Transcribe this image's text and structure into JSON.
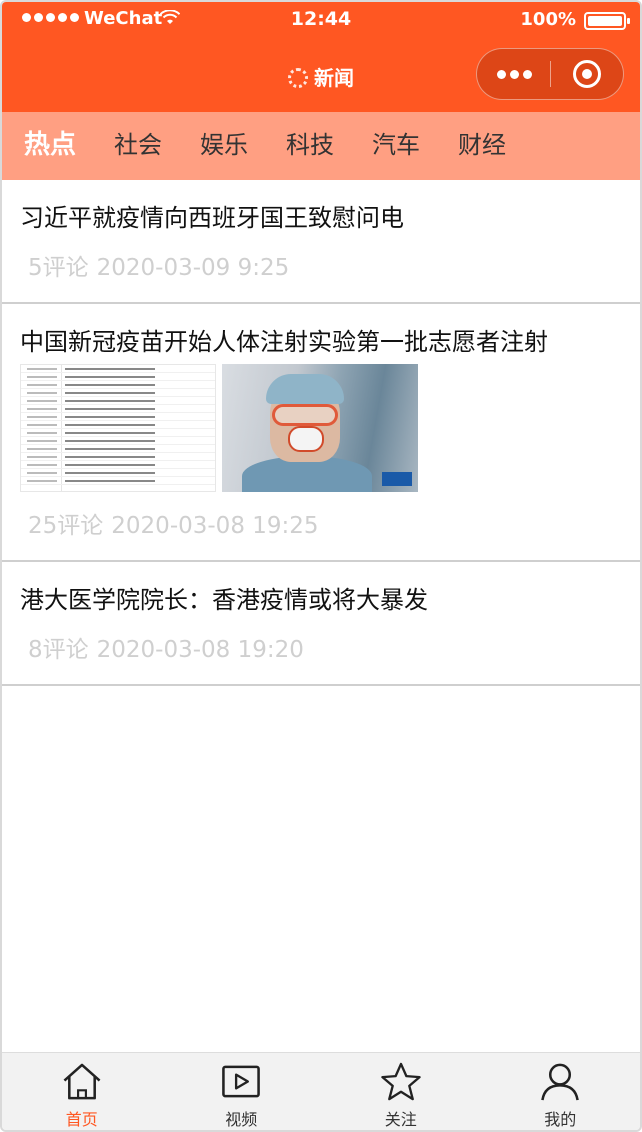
{
  "status_bar": {
    "carrier": "WeChat",
    "time": "12:44",
    "battery": "100%"
  },
  "nav": {
    "title": "新闻"
  },
  "tabs": [
    {
      "label": "热点",
      "active": true
    },
    {
      "label": "社会",
      "active": false
    },
    {
      "label": "娱乐",
      "active": false
    },
    {
      "label": "科技",
      "active": false
    },
    {
      "label": "汽车",
      "active": false
    },
    {
      "label": "财经",
      "active": false
    }
  ],
  "news": [
    {
      "title": "习近平就疫情向西班牙国王致慰问电",
      "comments": "5评论",
      "time": "2020-03-09 9:25"
    },
    {
      "title": "中国新冠疫苗开始人体注射实验第一批志愿者注射",
      "comments": "25评论",
      "time": "2020-03-08 19:25"
    },
    {
      "title": "港大医学院院长：香港疫情或将大暴发",
      "comments": "8评论",
      "time": "2020-03-08 19:20"
    }
  ],
  "tabbar": [
    {
      "label": "首页",
      "icon": "home-icon",
      "active": true
    },
    {
      "label": "视频",
      "icon": "video-icon",
      "active": false
    },
    {
      "label": "关注",
      "icon": "star-icon",
      "active": false
    },
    {
      "label": "我的",
      "icon": "user-icon",
      "active": false
    }
  ],
  "colors": {
    "brand": "#ff5722",
    "tabs_bg": "#ff9f82",
    "active_tab": "#ff5722"
  }
}
